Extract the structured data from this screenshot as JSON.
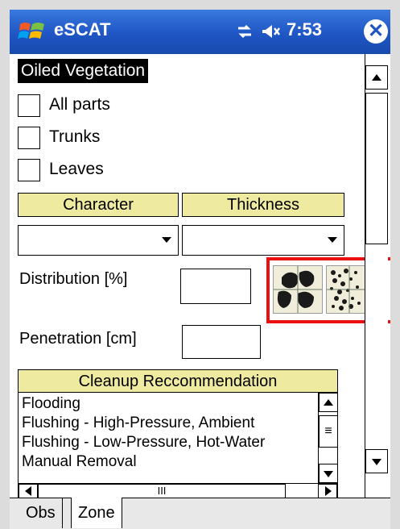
{
  "titlebar": {
    "app_title": "eSCAT",
    "time": "7:53",
    "icons": [
      "windows-start-icon",
      "connectivity-icon",
      "speaker-icon",
      "close-icon"
    ],
    "close_glyph": "✕"
  },
  "oiled_vegetation": {
    "header": "Oiled Vegetation",
    "options": [
      {
        "label": "All parts",
        "checked": false
      },
      {
        "label": "Trunks",
        "checked": false
      },
      {
        "label": "Leaves",
        "checked": false
      }
    ]
  },
  "columns": {
    "character_label": "Character",
    "thickness_label": "Thickness",
    "character_value": "",
    "thickness_value": ""
  },
  "distribution": {
    "label": "Distribution [%]",
    "value": "",
    "pattern_buttons": [
      "patches-pattern-icon",
      "speckled-pattern-icon"
    ]
  },
  "penetration": {
    "label": "Penetration [cm]",
    "value": ""
  },
  "cleanup": {
    "header": "Cleanup Reccommendation",
    "items": [
      "Flooding",
      "Flushing - High-Pressure, Ambient",
      "Flushing - Low-Pressure, Hot-Water",
      "Manual Removal"
    ],
    "hscroll_grip": "III",
    "vscroll_grip": "≡"
  },
  "tabs": [
    {
      "label": "Obs",
      "active": false
    },
    {
      "label": "Zone",
      "active": true
    }
  ],
  "colors": {
    "titlebar": "#1f56c4",
    "header_fill": "#eeeaa0",
    "highlight": "#e81010"
  }
}
